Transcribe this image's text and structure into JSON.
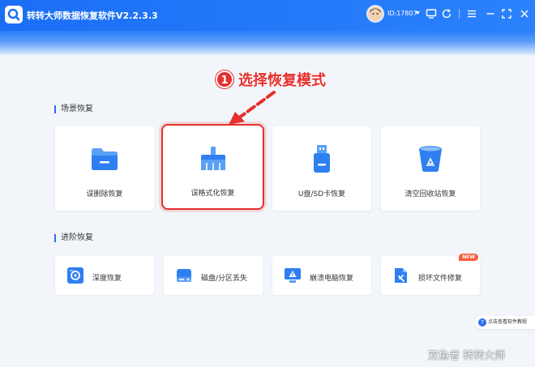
{
  "app": {
    "title": "转转大师数据恢复软件V2.2.3.3",
    "user_id": "ID:17807"
  },
  "annotation": {
    "step_number": "1",
    "step_text": "选择恢复模式"
  },
  "scene_recovery": {
    "title": "场景恢复",
    "cards": [
      {
        "label": "误删除恢复",
        "icon": "folder-icon"
      },
      {
        "label": "误格式化恢复",
        "icon": "broom-icon"
      },
      {
        "label": "U盘/SD卡恢复",
        "icon": "usb-drive-icon"
      },
      {
        "label": "清空回收站恢复",
        "icon": "recycle-bin-icon"
      }
    ]
  },
  "advanced_recovery": {
    "title": "进阶恢复",
    "cards": [
      {
        "label": "深度恢复",
        "icon": "deep-scan-icon"
      },
      {
        "label": "磁盘/分区丢失",
        "icon": "disk-icon"
      },
      {
        "label": "崩溃电脑恢复",
        "icon": "crashed-pc-icon"
      },
      {
        "label": "损坏文件修复",
        "icon": "repair-icon",
        "badge": "NEW"
      }
    ]
  },
  "tutorial_link": "点击查看软件教程",
  "watermark": "双鱼者  转转大师",
  "colors": {
    "primary": "#2b6ff2",
    "highlight": "#e5302f",
    "background": "#f2f6fb"
  }
}
